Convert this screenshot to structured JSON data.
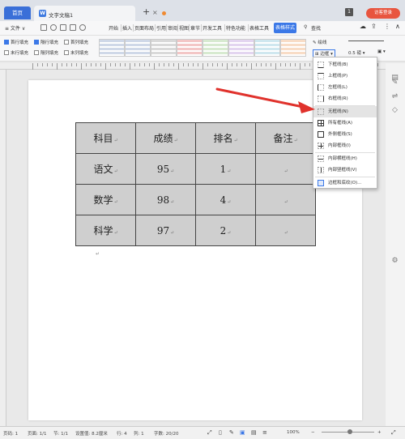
{
  "tabs": {
    "home": "首页",
    "doc": "文字文稿1"
  },
  "account": {
    "count": "1",
    "visitor": "访客登录"
  },
  "menu": {
    "file": "≡ 文件 ∨",
    "items": [
      "开始",
      "插入",
      "页面布局",
      "引用",
      "审阅",
      "视图",
      "章节",
      "开发工具",
      "特色功能",
      "表格工具"
    ],
    "active": "表格样式",
    "search": "查找"
  },
  "ribbon": {
    "checkboxes": [
      {
        "label": "首行填充",
        "checked": true
      },
      {
        "label": "隔行填充",
        "checked": true
      },
      {
        "label": "首列填充",
        "checked": false
      },
      {
        "label": "末行填充",
        "checked": false
      },
      {
        "label": "隔列填充",
        "checked": false
      },
      {
        "label": "末列填充",
        "checked": false
      }
    ],
    "pen_label": "绘线",
    "border_label": "边框",
    "line_width": "0.5",
    "line_width_unit": "磅",
    "swatch_colors": [
      "#cfd8e8",
      "#cfd8e8",
      "#d9d9d9",
      "#f3c6c6",
      "#d7ead0",
      "#e3d5f0",
      "#cfe7ef",
      "#f8dcc6"
    ]
  },
  "table": {
    "rows": [
      [
        "科目",
        "成绩",
        "排名",
        "备注"
      ],
      [
        "语文",
        "95",
        "1",
        ""
      ],
      [
        "数学",
        "98",
        "4",
        ""
      ],
      [
        "科学",
        "97",
        "2",
        ""
      ]
    ]
  },
  "border_menu": [
    {
      "label": "下框线(B)"
    },
    {
      "label": "上框线(P)"
    },
    {
      "label": "左框线(L)"
    },
    {
      "label": "右框线(R)"
    },
    {
      "label": "无框线(N)",
      "highlighted": true
    },
    {
      "label": "所有框线(A)"
    },
    {
      "label": "外侧框线(S)"
    },
    {
      "label": "内部框线(I)"
    },
    {
      "label": "内部横框线(H)"
    },
    {
      "label": "内部竖框线(V)"
    },
    {
      "label": "边框和底纹(O)..."
    }
  ],
  "status": {
    "page": "页码: 1",
    "pages": "页面: 1/1",
    "section": "节: 1/1",
    "setting": "设置值: 8.2厘米",
    "row": "行: 4",
    "col": "列: 1",
    "words": "字数: 20/20",
    "zoom": "100%"
  },
  "colors": {
    "accent": "#3b78e7",
    "arrow": "#e0322c",
    "table_bg": "#cfcfcf"
  }
}
